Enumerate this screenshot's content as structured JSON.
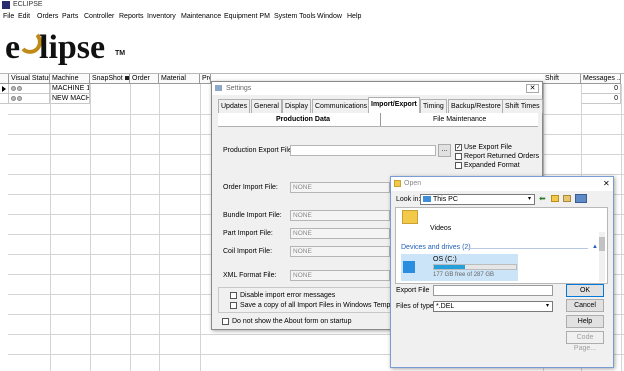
{
  "app": {
    "title": "ECLIPSE"
  },
  "menu": [
    "File",
    "Edit",
    "Orders",
    "Parts",
    "Controller",
    "Reports",
    "Inventory",
    "Maintenance",
    "Equipment PM",
    "System Tools",
    "Window",
    "Help"
  ],
  "logo": {
    "text": "eclipse",
    "mark": "TM"
  },
  "grid": {
    "columns": [
      "Visual Status",
      "Machine",
      "SnapShot",
      "Order",
      "Material",
      "Pro",
      "",
      "",
      "",
      "",
      "",
      "",
      "",
      "",
      "",
      "Shift",
      "Messages ..."
    ],
    "rows": [
      {
        "machine": "MACHINE 1",
        "messages": "0",
        "selected": true
      },
      {
        "machine": "NEW MACHIN",
        "messages": "0",
        "selected": false
      }
    ]
  },
  "settings": {
    "title": "Settings",
    "close": "✕",
    "tabs": [
      "Updates",
      "General",
      "Display",
      "Communications",
      "Import/Export",
      "Timing",
      "Backup/Restore",
      "Shift Times"
    ],
    "active_tab": "Import/Export",
    "subtabs": [
      "Production Data",
      "File Maintenance"
    ],
    "production_export_label": "Production Export File:",
    "browse": "...",
    "use_export_file": "Use Export File",
    "report_returned_orders": "Report Returned Orders",
    "expanded_format": "Expanded Format",
    "imports": [
      {
        "label": "Order Import File:",
        "value": "NONE"
      },
      {
        "label": "Bundle Import File:",
        "value": "NONE"
      },
      {
        "label": "Part Import File:",
        "value": "NONE"
      },
      {
        "label": "Coil Import File:",
        "value": "NONE"
      },
      {
        "label": "XML Format File:",
        "value": "NONE"
      }
    ],
    "disable_import_errors": "Disable import error messages",
    "save_copy": "Save a copy of all Import Files in Windows Temp direct",
    "dont_show_about": "Do not show the About form on startup"
  },
  "open": {
    "title": "Open",
    "close": "✕",
    "look_in_label": "Look in:",
    "look_in_value": "This PC",
    "videos": "Videos",
    "devices_header": "Devices and drives (2)",
    "drive_name": "OS (C:)",
    "drive_free": "177 GB free of 287 GB",
    "drive_used_fraction": 0.38,
    "export_file_label": "Export File",
    "files_of_type_label": "Files of type:",
    "files_of_type_value": "*.DEL",
    "ok": "OK",
    "cancel": "Cancel",
    "help": "Help",
    "code_page": "Code Page..."
  },
  "colors": {
    "accent": "#0078d7",
    "drive_bar": "#26a0da"
  }
}
